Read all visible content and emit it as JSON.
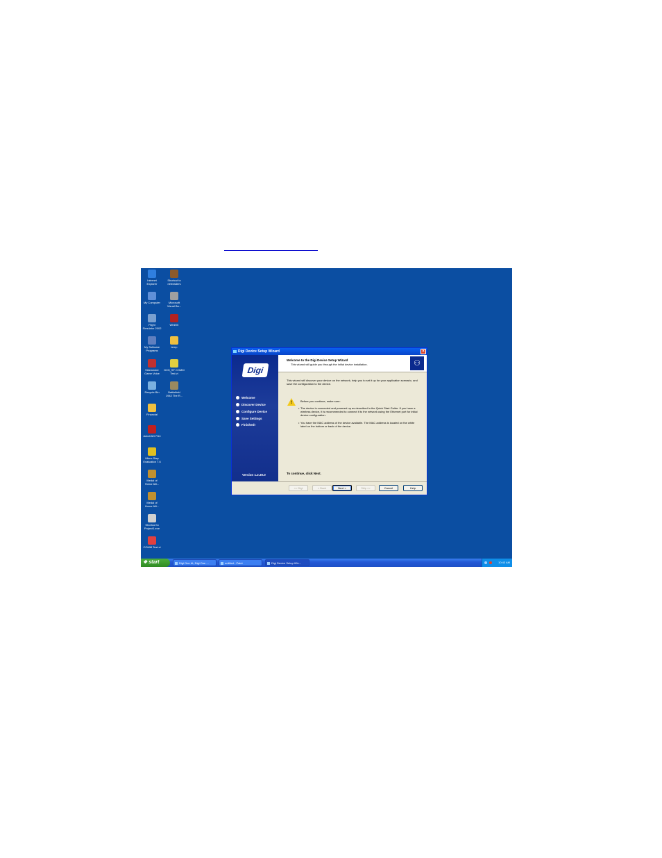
{
  "desktop": {
    "icons": [
      {
        "label": "Internet\nExplorer",
        "color": "#2f7fe0"
      },
      {
        "label": "Shortcut to\nnetreaders",
        "color": "#8b5a2b"
      },
      {
        "label": "My Computer",
        "color": "#5f8fd8"
      },
      {
        "label": "Microsoft\nVisual Ba...",
        "color": "#a0a0a0"
      },
      {
        "label": "Flight\nSimulator 2002",
        "color": "#7aa0d0"
      },
      {
        "label": "WinMX",
        "color": "#b22222"
      },
      {
        "label": "My Software\nPrograms",
        "color": "#5f7fbf"
      },
      {
        "label": "temp",
        "color": "#f0c040"
      },
      {
        "label": "Sidewinder\nGame Voice",
        "color": "#c03030"
      },
      {
        "label": "DIGI_SF COMM\nTest.vi",
        "color": "#e0d040"
      },
      {
        "label": "Recycle Bin",
        "color": "#7ab0e0"
      },
      {
        "label": "Battlefield\n1942 The R...",
        "color": "#9a8a60"
      },
      {
        "label": "Financial",
        "color": "#f0c040"
      },
      {
        "label": "AutoCAD R14",
        "color": "#c02020"
      },
      {
        "label": "Micro-Stap\nEvaluation 7.6",
        "color": "#e0c020"
      },
      {
        "label": "Medal of\nHonor Alli...",
        "color": "#c09030"
      },
      {
        "label": "Medal of\nHonor Alli...",
        "color": "#c09030"
      },
      {
        "label": "Shortcut to\nProject1.exe",
        "color": "#d0d0d0"
      },
      {
        "label": "COMM Test.vi",
        "color": "#e04040"
      }
    ]
  },
  "taskbar": {
    "start_label": "start",
    "tasks": [
      {
        "label": "Digi One IA, Digi One ..."
      },
      {
        "label": "untitled - Paint"
      },
      {
        "label": "Digi Device Setup Wiz..."
      }
    ],
    "clock": "10:43 AM"
  },
  "wizard": {
    "title": "Digi Device Setup Wizard",
    "close_glyph": "×",
    "logo": "Digi",
    "header_title": "Welcome to the Digi Device Setup Wizard",
    "header_subtitle": "This wizard will guide you through the initial device installation.",
    "steps": [
      "Welcome",
      "Discover Device",
      "Configure Device",
      "Save Settings",
      "Finished!"
    ],
    "version": "Version 1.2.30.0",
    "intro": "This wizard will discover your device on the network, help you to set it up for your application scenario, and save the configuration to the device.",
    "before_continue": "Before you continue, make sure:",
    "bullet1": "The device is connected and powered up as described in the Quick Start Guide. If you have a wireless device, it is recommended to connect it to the network using the Ethernet port for initial device configuration.",
    "bullet2": "You have the MAC address of the device available. The MAC address is located on the white label on the bottom or back of the device.",
    "continue_text": "To continue, click Next.",
    "buttons": {
      "digi": "<< Digi",
      "back": "< Back",
      "next": "Next >",
      "skip": "Skip >>",
      "cancel": "Cancel",
      "help": "Help"
    }
  }
}
